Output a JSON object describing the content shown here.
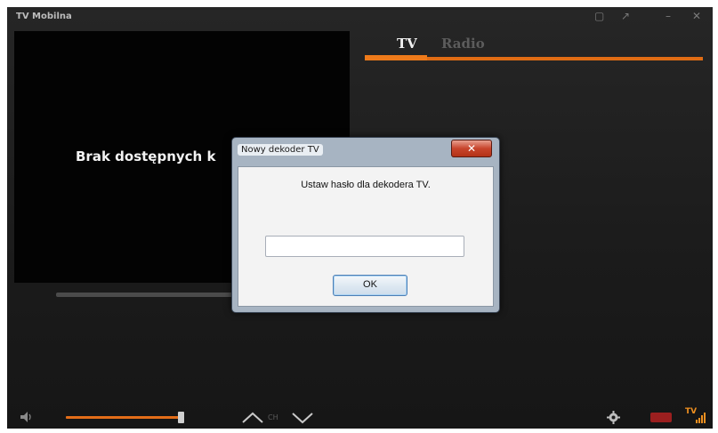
{
  "app": {
    "title": "TV Mobilna"
  },
  "video": {
    "status_text": "Brak dostępnych k"
  },
  "tabs": [
    {
      "label": "TV",
      "active": true
    },
    {
      "label": "Radio",
      "active": false
    }
  ],
  "dialog": {
    "title": "Nowy dekoder TV",
    "close_label": "✕",
    "message": "Ustaw hasło dla dekodera TV.",
    "input_value": "",
    "ok_label": "OK"
  },
  "controls": {
    "channel_label": "CH",
    "volume_level": 1.0,
    "logo_text": "TV"
  },
  "colors": {
    "accent": "#e36d18",
    "background": "#1d1d1d"
  }
}
